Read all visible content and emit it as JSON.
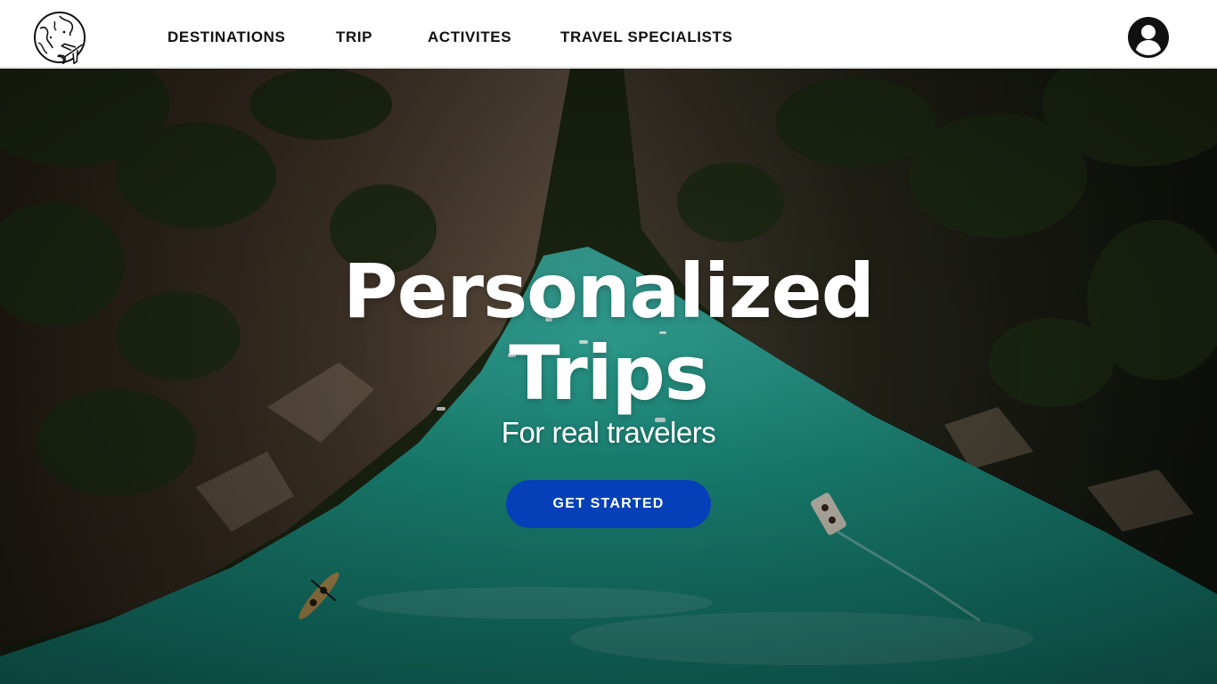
{
  "header": {
    "logo_icon": "globe-airplane-logo-icon",
    "nav": {
      "destinations": "DESTINATIONS",
      "trip": "TRIP",
      "activites": "ACTIVITES",
      "travel_specialists": "TRAVEL SPECIALISTS"
    },
    "account_icon": "user-account-icon"
  },
  "hero": {
    "title_line1": "Personalized",
    "title_line2": "Trips",
    "subtitle": "For real travelers",
    "cta_label": "GET STARTED",
    "background": "aerial-canyon-river-photo"
  },
  "colors": {
    "cta": "#0640b8",
    "water": "#1f9e8c",
    "cliffs": "#3a2e25",
    "forest": "#1f2a14"
  }
}
